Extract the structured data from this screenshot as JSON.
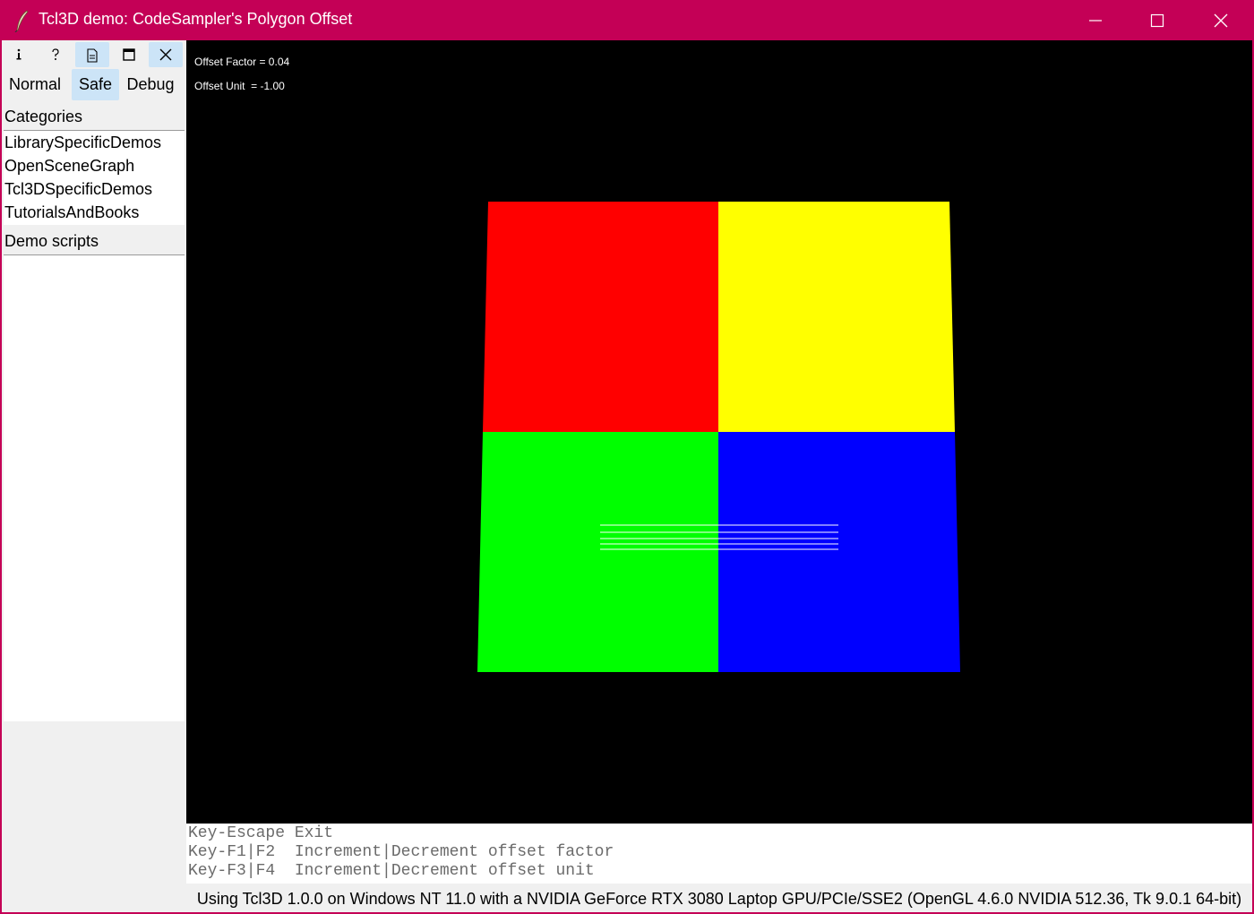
{
  "window": {
    "title": "Tcl3D demo: CodeSampler's Polygon Offset",
    "accent_color": "#c40056"
  },
  "toolbar": {
    "icons": [
      "info-icon",
      "help-icon",
      "document-icon",
      "maximize-icon",
      "close-icon"
    ],
    "active_icon": "document-icon",
    "modes": [
      "Normal",
      "Safe",
      "Debug"
    ],
    "active_mode": "Safe"
  },
  "categories": {
    "label": "Categories",
    "items": [
      "LibrarySpecificDemos",
      "OpenSceneGraph",
      "Tcl3DSpecificDemos",
      "TutorialsAndBooks"
    ]
  },
  "demo_scripts": {
    "label": "Demo scripts",
    "items": []
  },
  "viewport": {
    "offset_factor": "Offset Factor = 0.04",
    "offset_unit": "Offset Unit  = -1.00",
    "quad_colors": {
      "top_left": "#ff0000",
      "top_right": "#ffff00",
      "bottom_left": "#00ff00",
      "bottom_right": "#0000ff"
    }
  },
  "help": {
    "lines": [
      "Key-Escape Exit",
      "Key-F1|F2  Increment|Decrement offset factor",
      "Key-F3|F4  Increment|Decrement offset unit"
    ]
  },
  "status": {
    "text": "Using Tcl3D 1.0.0 on Windows NT 11.0 with a NVIDIA GeForce RTX 3080 Laptop GPU/PCIe/SSE2 (OpenGL 4.6.0 NVIDIA 512.36, Tk 9.0.1 64-bit)"
  }
}
